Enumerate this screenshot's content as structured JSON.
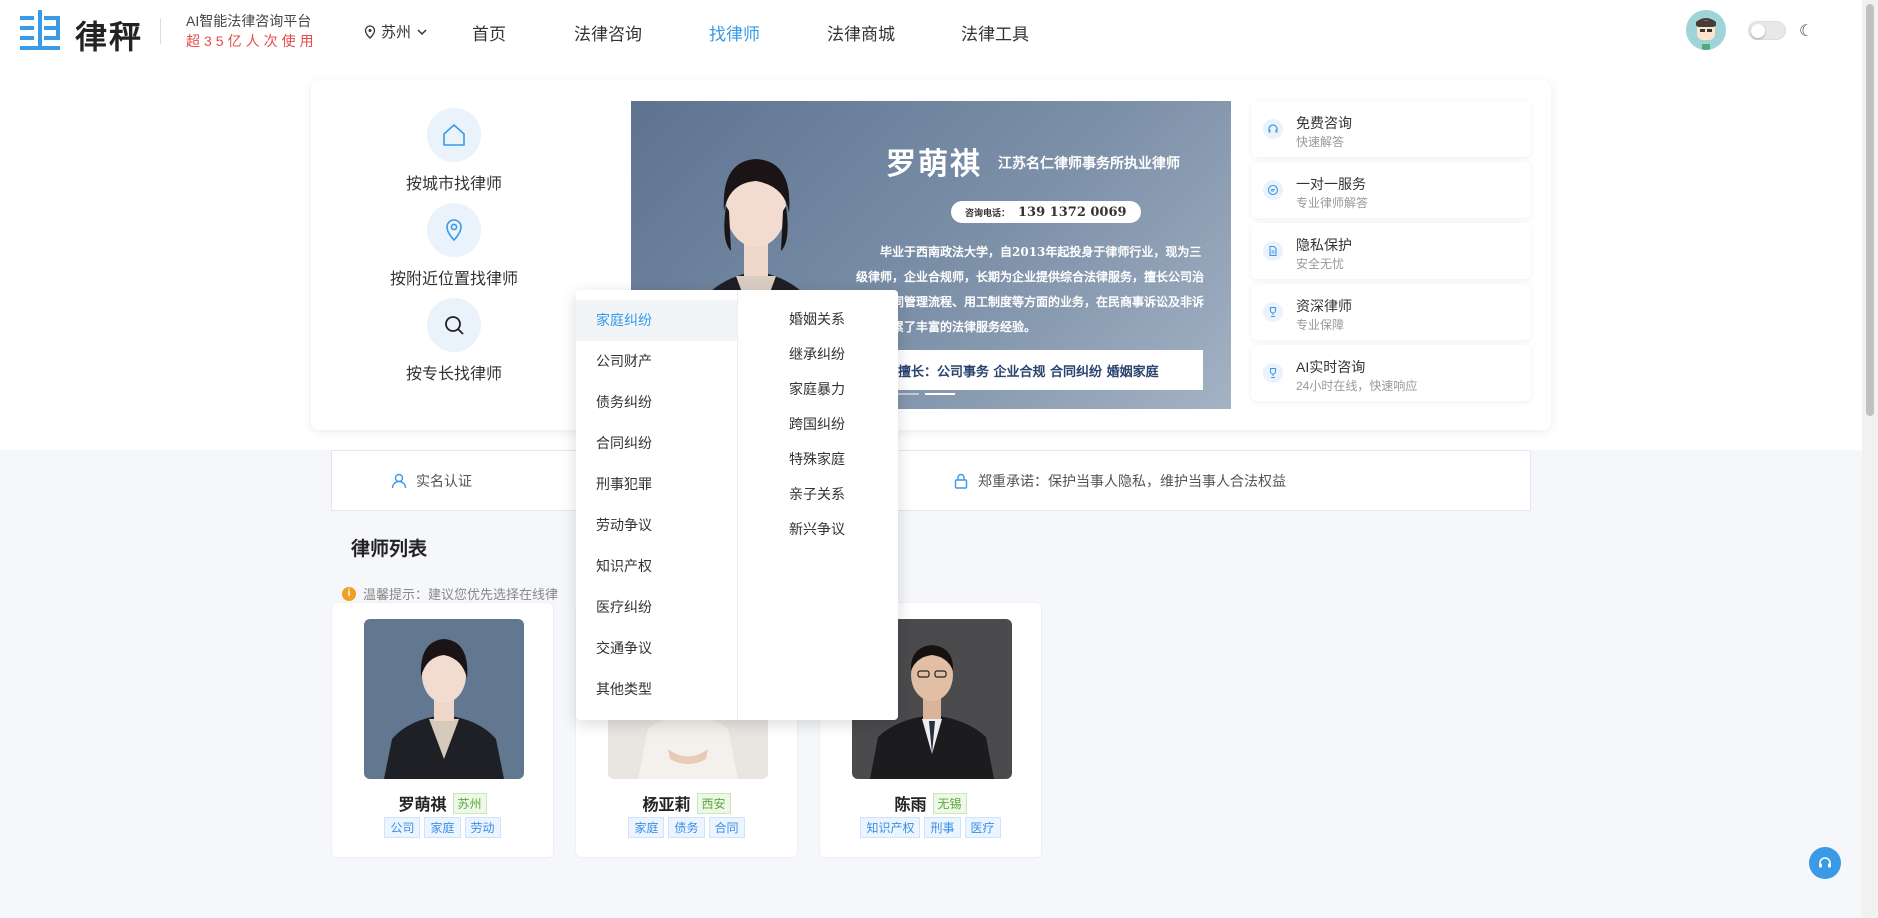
{
  "header": {
    "logo_text": "律秤",
    "tagline": "AI智能法律咨询平台",
    "tagline_sub": "超35亿人次使用",
    "city": "苏州",
    "nav": [
      "首页",
      "法律咨询",
      "找律师",
      "法律商城",
      "法律工具"
    ],
    "active_nav": "找律师",
    "brand_color": "#3a9ae6"
  },
  "find_options": [
    {
      "label": "按城市找律师",
      "icon": "home-icon"
    },
    {
      "label": "按附近位置找律师",
      "icon": "location-pin-icon"
    },
    {
      "label": "按专长找律师",
      "icon": "search-icon"
    }
  ],
  "banner": {
    "name": "罗萌祺",
    "firm": "江苏名仁律师事务所执业律师",
    "phone_label": "咨询电话：",
    "phone": "139 1372 0069",
    "bio": "毕业于西南政法大学，自2013年起投身于律师行业，现为三级律师，企业合规师，长期为企业提供综合法律服务，擅长公司治理、合同管理流程、用工制度等方面的业务，在民商事诉讼及非诉领域积累了丰富的法律服务经验。",
    "specialty": "擅长：公司事务 企业合规 合同纠纷 婚姻家庭"
  },
  "features": [
    {
      "title": "免费咨询",
      "desc": "快速解答",
      "icon": "headset-icon"
    },
    {
      "title": "一对一服务",
      "desc": "专业律师解答",
      "icon": "chat-icon"
    },
    {
      "title": "隐私保护",
      "desc": "安全无忧",
      "icon": "document-icon"
    },
    {
      "title": "资深律师",
      "desc": "专业保障",
      "icon": "trophy-icon"
    },
    {
      "title": "AI实时咨询",
      "desc": "24小时在线，快速响应",
      "icon": "trophy-icon"
    }
  ],
  "trust": {
    "item1": "实名认证",
    "item2": "郑重承诺：保护当事人隐私，维护当事人合法权益"
  },
  "list": {
    "title": "律师列表",
    "tip": "温馨提示：建议您优先选择在线律"
  },
  "lawyers": [
    {
      "name": "罗萌祺",
      "city": "苏州",
      "tags": [
        "公司",
        "家庭",
        "劳动"
      ]
    },
    {
      "name": "杨亚莉",
      "city": "西安",
      "tags": [
        "家庭",
        "债务",
        "合同"
      ]
    },
    {
      "name": "陈雨",
      "city": "无锡",
      "tags": [
        "知识产权",
        "刑事",
        "医疗"
      ]
    }
  ],
  "dropdown": {
    "categories": [
      "家庭纠纷",
      "公司财产",
      "债务纠纷",
      "合同纠纷",
      "刑事犯罪",
      "劳动争议",
      "知识产权",
      "医疗纠纷",
      "交通争议",
      "其他类型"
    ],
    "active": "家庭纠纷",
    "subcategories": [
      "婚姻关系",
      "继承纠纷",
      "家庭暴力",
      "跨国纠纷",
      "特殊家庭",
      "亲子关系",
      "新兴争议"
    ]
  }
}
